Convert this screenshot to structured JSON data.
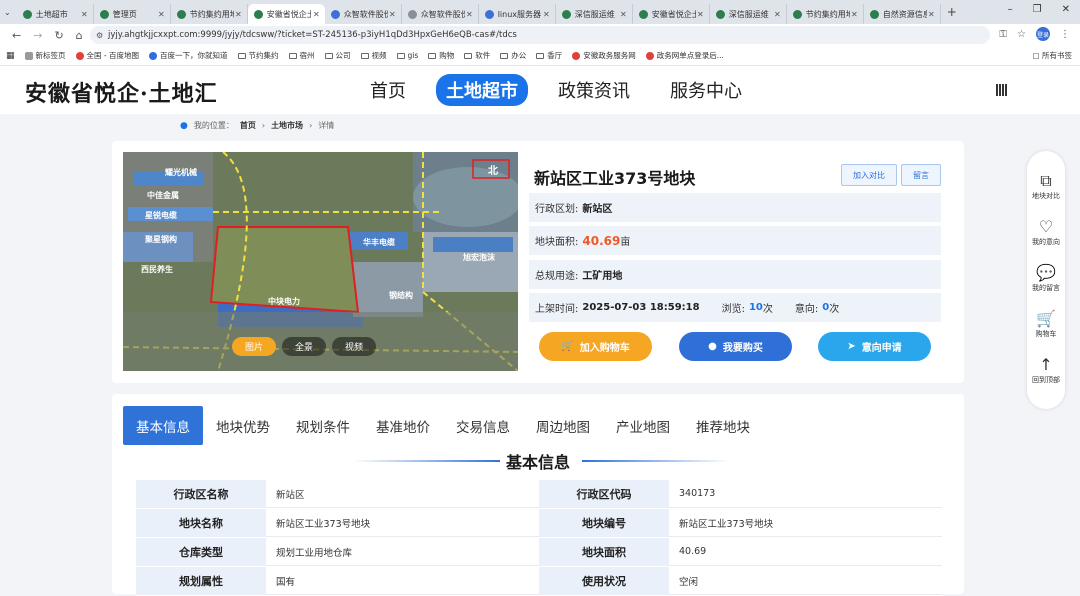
{
  "browser": {
    "tabs": [
      {
        "title": "土地超市",
        "favicon": "green"
      },
      {
        "title": "管理页",
        "favicon": "green"
      },
      {
        "title": "节约集约用地",
        "favicon": "green"
      },
      {
        "title": "安徽省悦企土地",
        "favicon": "green",
        "active": true
      },
      {
        "title": "众智软件股份",
        "favicon": "blue"
      },
      {
        "title": "众智软件股份",
        "favicon": "gray"
      },
      {
        "title": "linux服务器",
        "favicon": "blue"
      },
      {
        "title": "深信服运维",
        "favicon": "green"
      },
      {
        "title": "安徽省悦企土地",
        "favicon": "green"
      },
      {
        "title": "深信服运维",
        "favicon": "green"
      },
      {
        "title": "节约集约用地",
        "favicon": "green"
      },
      {
        "title": "自然资源信息",
        "favicon": "green"
      }
    ],
    "new_tab": "+",
    "url": "jyjy.ahgtkjjcxxpt.com:9999/jyjy/tdcsww/?ticket=ST-245136-p3iyH1qDd3HpxGeH6eQB-cas#/tdcs",
    "profile": "登录",
    "bookmarks": [
      {
        "label": "新标签页",
        "icon": "chrome"
      },
      {
        "label": "全国 - 百度地图",
        "icon": "red"
      },
      {
        "label": "百度一下，你就知道",
        "icon": "blue"
      },
      {
        "label": "节约集约",
        "icon": "folder"
      },
      {
        "label": "宿州",
        "icon": "folder"
      },
      {
        "label": "公司",
        "icon": "folder"
      },
      {
        "label": "视频",
        "icon": "folder"
      },
      {
        "label": "gis",
        "icon": "folder"
      },
      {
        "label": "购物",
        "icon": "folder"
      },
      {
        "label": "软件",
        "icon": "folder"
      },
      {
        "label": "办公",
        "icon": "folder"
      },
      {
        "label": "香厅",
        "icon": "folder"
      },
      {
        "label": "安徽政务服务网",
        "icon": "red"
      },
      {
        "label": "政务网单点登录后...",
        "icon": "red"
      }
    ],
    "all_bookmarks": "所有书签"
  },
  "site": {
    "logo": "安徽省悦企·土地汇",
    "nav": [
      "首页",
      "土地超市",
      "政策资讯",
      "服务中心"
    ],
    "nav_active": 1
  },
  "breadcrumb": {
    "prefix": "我的位置：",
    "items": [
      "首页",
      "土地市场",
      "详情"
    ]
  },
  "image": {
    "tabs": [
      "图片",
      "全景",
      "视频"
    ],
    "active": 0,
    "map_labels": [
      "耀光机械",
      "中佳金属",
      "星锐电缆",
      "聚星钢构",
      "西民养生",
      "华丰电缆",
      "旭宏泡沫",
      "中块电力",
      "钢结构",
      "北"
    ]
  },
  "plot": {
    "title": "新站区工业373号地块",
    "compare_label": "加入对比",
    "message_label": "留言",
    "district_label": "行政区划:",
    "district": "新站区",
    "area_label": "地块面积:",
    "area_value": "40.69",
    "area_unit": "亩",
    "use_label": "总规用途:",
    "use": "工矿用地",
    "listed_label": "上架时间:",
    "listed": "2025-07-03 18:59:18",
    "views_label": "浏览:",
    "views": "10",
    "views_unit": "次",
    "intent_label": "意向:",
    "intent": "0",
    "intent_unit": "次",
    "actions": [
      {
        "label": "加入购物车",
        "color": "#f5a623",
        "icon": "cart"
      },
      {
        "label": "我要购买",
        "color": "#2f6fd8",
        "icon": "dot"
      },
      {
        "label": "意向申请",
        "color": "#2aa7ec",
        "icon": "send"
      }
    ]
  },
  "side_panel": [
    {
      "label": "地块对比",
      "icon": "compare"
    },
    {
      "label": "我的意向",
      "icon": "heart-plus"
    },
    {
      "label": "我的留言",
      "icon": "message"
    },
    {
      "label": "购物车",
      "icon": "cart"
    },
    {
      "label": "回到顶部",
      "icon": "arrow-up"
    }
  ],
  "detail_tabs": [
    "基本信息",
    "地块优势",
    "规划条件",
    "基准地价",
    "交易信息",
    "周边地图",
    "产业地图",
    "推荐地块"
  ],
  "detail_active": 0,
  "section_title": "基本信息",
  "basic_info": [
    [
      "行政区名称",
      "新站区",
      "行政区代码",
      "340173"
    ],
    [
      "地块名称",
      "新站区工业373号地块",
      "地块编号",
      "新站区工业373号地块"
    ],
    [
      "仓库类型",
      "规划工业用地仓库",
      "地块面积",
      "40.69"
    ],
    [
      "规划属性",
      "国有",
      "使用状况",
      "空闲"
    ]
  ]
}
